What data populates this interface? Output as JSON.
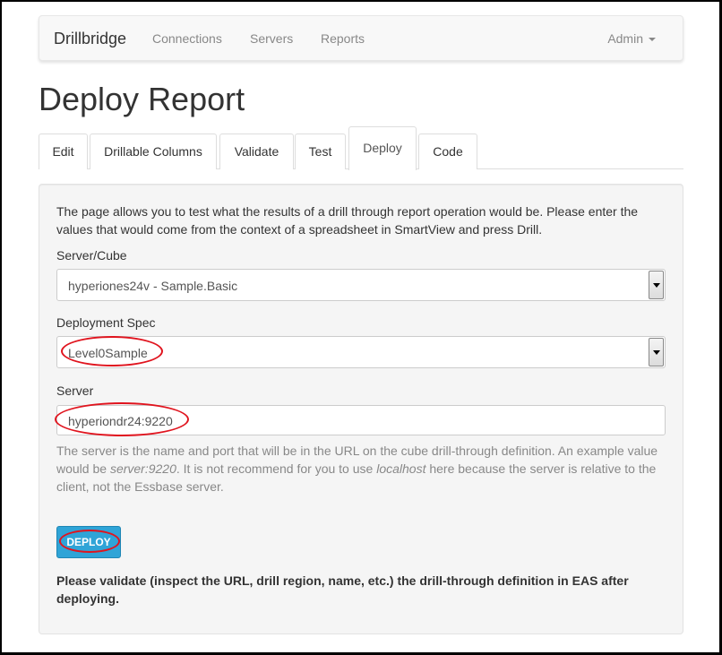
{
  "navbar": {
    "brand": "Drillbridge",
    "links": [
      "Connections",
      "Servers",
      "Reports"
    ],
    "admin": "Admin"
  },
  "page_title": "Deploy Report",
  "tabs": [
    "Edit",
    "Drillable Columns",
    "Validate",
    "Test",
    "Deploy",
    "Code"
  ],
  "active_tab": "Deploy",
  "form": {
    "intro": "The page allows you to test what the results of a drill through report operation would be. Please enter the values that would come from the context of a spreadsheet in SmartView and press Drill.",
    "server_cube_label": "Server/Cube",
    "server_cube_value": "hyperiones24v - Sample.Basic",
    "deployment_spec_label": "Deployment Spec",
    "deployment_spec_value": "Level0Sample",
    "server_label": "Server",
    "server_value": "hyperiondr24:9220",
    "help_part1": "The server is the name and port that will be in the URL on the cube drill-through definition. An example value would be ",
    "help_example": "server:9220",
    "help_part2": ". It is not recommend for you to use ",
    "help_localhost": "localhost",
    "help_part3": " here because the server is relative to the client, not the Essbase server.",
    "deploy_button": "DEPLOY",
    "note": "Please validate (inspect the URL, drill region, name, etc.) the drill-through definition in EAS after deploying."
  },
  "colors": {
    "primary": "#2fa4d7",
    "annotation": "#e0141e"
  }
}
